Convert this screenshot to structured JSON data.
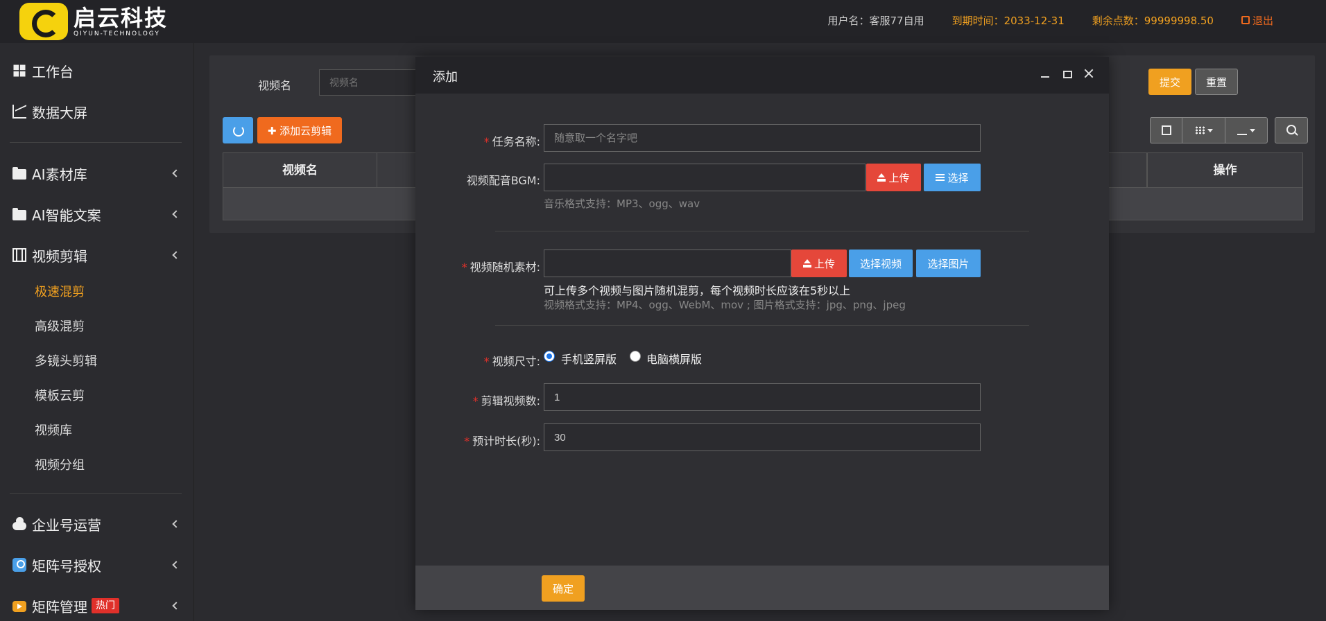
{
  "header": {
    "logo_cn": "启云科技",
    "logo_en": "QIYUN-TECHNOLOGY",
    "user": "用户名：客服77自用",
    "expiry": "到期时间：2033-12-31",
    "points": "剩余点数：99999998.50",
    "logout": "退出"
  },
  "sidebar": {
    "items": [
      {
        "label": "工作台",
        "icon": "windows-icon"
      },
      {
        "label": "数据大屏",
        "icon": "line-chart-icon"
      },
      {
        "label": "AI素材库",
        "icon": "folder-icon"
      },
      {
        "label": "AI智能文案",
        "icon": "folder-icon"
      },
      {
        "label": "视频剪辑",
        "icon": "film-icon"
      },
      {
        "label": "企业号运营",
        "icon": "cloud-icon"
      },
      {
        "label": "矩阵号授权",
        "icon": "user-icon"
      },
      {
        "label": "矩阵管理",
        "icon": "play-icon",
        "badge": "热门"
      }
    ],
    "sub_items": [
      "极速混剪",
      "高级混剪",
      "多镜头剪辑",
      "模板云剪",
      "视频库",
      "视频分组"
    ],
    "active_sub": "极速混剪"
  },
  "main": {
    "search_label": "视频名",
    "search_placeholder": "视频名",
    "submit": "提交",
    "reset": "重置",
    "add_cloud": "✚ 添加云剪辑",
    "columns": [
      "视频名",
      "操作"
    ]
  },
  "modal": {
    "title": "添加",
    "task_name_label": "任务名称:",
    "task_name_placeholder": "随意取一个名字吧",
    "bgm_label": "视频配音BGM:",
    "upload": "上传",
    "select": "选择",
    "bgm_help": "音乐格式支持：MP3、ogg、wav",
    "material_label": "视频随机素材:",
    "select_video": "选择视频",
    "select_image": "选择图片",
    "material_help_strong": "可上传多个视频与图片随机混剪，每个视频时长应该在5秒以上",
    "material_help": "视频格式支持：MP4、ogg、WebM、mov ; 图片格式支持：jpg、png、jpeg",
    "size_label": "视频尺寸:",
    "size_options": [
      "手机竖屏版",
      "电脑横屏版"
    ],
    "size_selected": "手机竖屏版",
    "count_label": "剪辑视频数:",
    "count_value": "1",
    "duration_label": "预计时长(秒):",
    "duration_value": "30",
    "confirm": "确定"
  },
  "colors": {
    "accent_orange": "#f0a020",
    "danger_red": "#e5473a",
    "primary_blue": "#4a9fe8"
  }
}
